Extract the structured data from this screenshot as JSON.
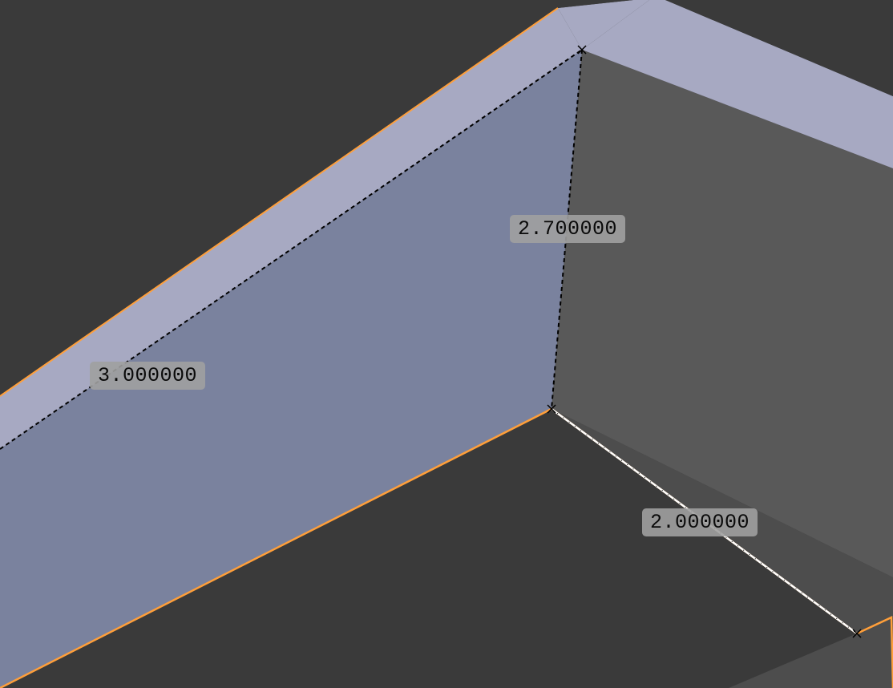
{
  "measurements": {
    "label_left": "3.000000",
    "label_top": "2.700000",
    "label_right": "2.000000"
  }
}
